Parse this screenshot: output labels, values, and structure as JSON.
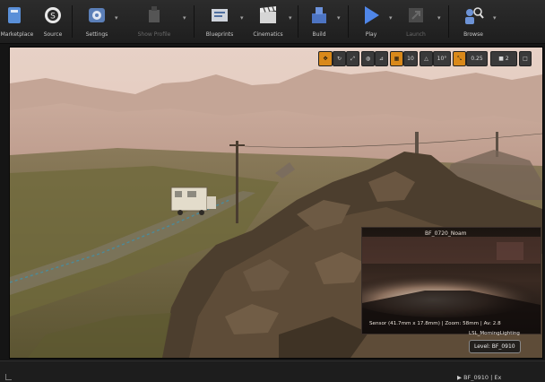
{
  "toolbar": {
    "items": [
      {
        "label": "Marketplace",
        "icon": "marketplace-icon",
        "enabled": true
      },
      {
        "label": "Source",
        "icon": "source-control-icon",
        "enabled": true
      },
      {
        "label": "Settings",
        "icon": "settings-icon",
        "enabled": true
      },
      {
        "label": "Show Profile",
        "icon": "profile-icon",
        "enabled": false
      },
      {
        "label": "Blueprints",
        "icon": "blueprints-icon",
        "enabled": true
      },
      {
        "label": "Cinematics",
        "icon": "cinematics-icon",
        "enabled": true
      },
      {
        "label": "Build",
        "icon": "build-icon",
        "enabled": true
      },
      {
        "label": "Play",
        "icon": "play-icon",
        "enabled": true
      },
      {
        "label": "Launch",
        "icon": "launch-icon",
        "enabled": false
      },
      {
        "label": "Browse",
        "icon": "browse-icon",
        "enabled": true
      }
    ]
  },
  "viewport_tools": {
    "grid_snap": "10",
    "rotation_snap": "10°",
    "scale_snap": "0.25",
    "camera_speed": "2"
  },
  "preview": {
    "title": "BF_0720_Noam",
    "info": "Sensor (41.7mm x 17.8mm) | Zoom: 58mm | Av: 2.8"
  },
  "viewport_info": {
    "lighting": "LSL_MorningLighting",
    "level_label": "Level:  BF_0910"
  },
  "bottom_bar": {
    "level": "BF_0910 | Ex"
  },
  "colors": {
    "accent": "#d9891a",
    "toolbar_bg": "#2c2c2c",
    "sky": "#e6cec1"
  }
}
